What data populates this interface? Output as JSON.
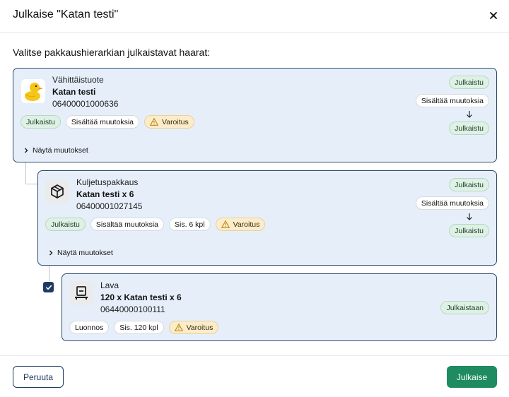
{
  "dialog": {
    "title": "Julkaise \"Katan testi\"",
    "prompt": "Valitse pakkaushierarkian julkaistavat haarat:"
  },
  "cards": [
    {
      "type": "Vähittäistuote",
      "name": "Katan testi",
      "code": "06400001000636",
      "icon": "rubber-duck-image",
      "badges": [
        "Julkaistu",
        "Sisältää muutoksia",
        "Varoitus"
      ],
      "status_from": "Julkaistu",
      "status_change": "Sisältää muutoksia",
      "status_to": "Julkaistu",
      "show_changes": "Näytä muutokset"
    },
    {
      "type": "Kuljetuspakkaus",
      "name": "Katan testi x 6",
      "code": "06400001027145",
      "icon": "package-box-icon",
      "badges": [
        "Julkaistu",
        "Sisältää muutoksia",
        "Sis. 6 kpl",
        "Varoitus"
      ],
      "status_from": "Julkaistu",
      "status_change": "Sisältää muutoksia",
      "status_to": "Julkaistu",
      "show_changes": "Näytä muutokset"
    },
    {
      "type": "Lava",
      "name": "120 x Katan testi x 6",
      "code": "06440000100111",
      "icon": "pallet-icon",
      "badges": [
        "Luonnos",
        "Sis. 120 kpl",
        "Varoitus"
      ],
      "status": "Julkaistaan",
      "selected": true
    }
  ],
  "footer": {
    "cancel_label": "Peruuta",
    "publish_label": "Julkaise"
  },
  "colors": {
    "card_bg": "#e6eff9",
    "card_border": "#2e4a6b",
    "primary_button": "#1f8c5f",
    "badge_green": "#def1e4",
    "badge_warning": "#fbeccb"
  }
}
